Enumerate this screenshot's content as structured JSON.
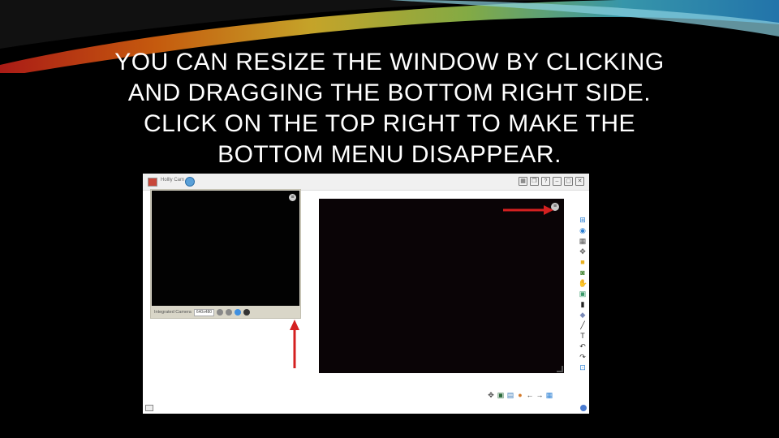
{
  "slide": {
    "title_lines": [
      "YOU CAN RESIZE THE WINDOW BY CLICKING",
      "AND DRAGGING THE BOTTOM RIGHT SIDE.",
      "CLICK ON THE TOP RIGHT TO MAKE THE",
      "BOTTOM MENU DISAPPEAR."
    ]
  },
  "app": {
    "name": "Hollly Cam",
    "camera_panel": {
      "camera_label": "Integrated Camera",
      "resolution": "640x480",
      "menu_glyph": "≡"
    },
    "big_view": {
      "menu_glyph": "≡"
    },
    "titlebar_icons": [
      "grid-icon",
      "copy-icon",
      "help-icon",
      "minimize-icon",
      "maximize-icon",
      "close-icon"
    ],
    "titlebar_glyphs": [
      "▦",
      "❐",
      "?",
      "–",
      "▢",
      "✕"
    ],
    "side_tools": [
      {
        "name": "windows-icon",
        "glyph": "⊞",
        "color": "#2a7fd4"
      },
      {
        "name": "globe-icon",
        "glyph": "◉",
        "color": "#2a7fd4"
      },
      {
        "name": "gallery-icon",
        "glyph": "▦",
        "color": "#555555"
      },
      {
        "name": "move-icon",
        "glyph": "✥",
        "color": "#555555"
      },
      {
        "name": "folder-icon",
        "glyph": "■",
        "color": "#e8b020"
      },
      {
        "name": "camera-icon",
        "glyph": "◙",
        "color": "#4a8a3a"
      },
      {
        "name": "hand-icon",
        "glyph": "✋",
        "color": "#d49a60"
      },
      {
        "name": "image-edit-icon",
        "glyph": "▣",
        "color": "#3a9a6a"
      },
      {
        "name": "marker-icon",
        "glyph": "▮",
        "color": "#222222"
      },
      {
        "name": "eraser-icon",
        "glyph": "◆",
        "color": "#7a8ab8"
      },
      {
        "name": "line-icon",
        "glyph": "╱",
        "color": "#333333"
      },
      {
        "name": "text-icon",
        "glyph": "T",
        "color": "#333333"
      },
      {
        "name": "undo-icon",
        "glyph": "↶",
        "color": "#333333"
      },
      {
        "name": "redo-icon",
        "glyph": "↷",
        "color": "#333333"
      },
      {
        "name": "crop-icon",
        "glyph": "⊡",
        "color": "#2a7fd4"
      }
    ],
    "bottom_tools": [
      {
        "name": "move-icon",
        "glyph": "✥",
        "color": "#444444"
      },
      {
        "name": "photo-icon",
        "glyph": "▣",
        "color": "#2a6a3a"
      },
      {
        "name": "notes-icon",
        "glyph": "▤",
        "color": "#3a7ab8"
      },
      {
        "name": "palette-icon",
        "glyph": "●",
        "color": "#d47a2a"
      },
      {
        "name": "back-arrow-icon",
        "glyph": "←",
        "color": "#333333"
      },
      {
        "name": "forward-arrow-icon",
        "glyph": "→",
        "color": "#333333"
      },
      {
        "name": "gallery-icon",
        "glyph": "▦",
        "color": "#2a7fd4"
      }
    ]
  },
  "colors": {
    "arrow": "#d42020",
    "background": "#000000"
  }
}
